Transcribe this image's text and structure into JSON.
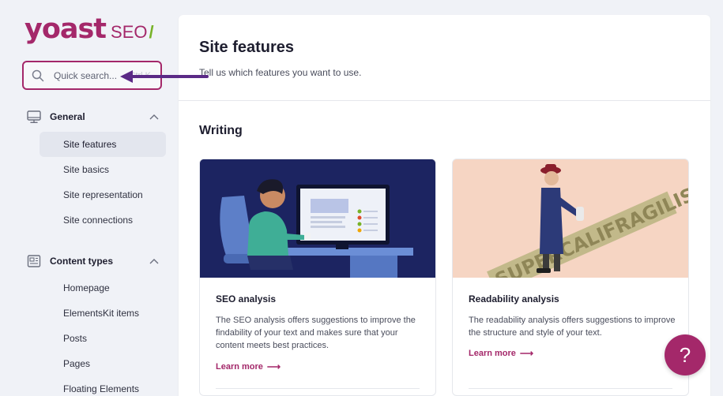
{
  "brand": {
    "logo_word": "yoast",
    "logo_suffix": "SEO",
    "logo_slash": "/",
    "primary_color": "#a4286a",
    "accent_color": "#77b227"
  },
  "search": {
    "placeholder": "Quick search...",
    "shortcut": "Ctrl K",
    "icon": "search-icon"
  },
  "sidebar": {
    "sections": [
      {
        "label": "General",
        "icon": "desktop-icon",
        "expanded": true,
        "items": [
          {
            "label": "Site features",
            "active": true
          },
          {
            "label": "Site basics",
            "active": false
          },
          {
            "label": "Site representation",
            "active": false
          },
          {
            "label": "Site connections",
            "active": false
          }
        ]
      },
      {
        "label": "Content types",
        "icon": "newspaper-icon",
        "expanded": true,
        "items": [
          {
            "label": "Homepage",
            "active": false
          },
          {
            "label": "ElementsKit items",
            "active": false
          },
          {
            "label": "Posts",
            "active": false
          },
          {
            "label": "Pages",
            "active": false
          },
          {
            "label": "Floating Elements",
            "active": false
          }
        ]
      }
    ]
  },
  "main": {
    "title": "Site features",
    "subtitle": "Tell us which features you want to use.",
    "section_title": "Writing",
    "cards": [
      {
        "title": "SEO analysis",
        "description": "The SEO analysis offers suggestions to improve the findability of your text and makes sure that your content meets best practices.",
        "link": "Learn more",
        "link_arrow": "⟶"
      },
      {
        "title": "Readability analysis",
        "description": "The readability analysis offers suggestions to improve the structure and style of your text.",
        "link": "Learn more",
        "link_arrow": "⟶",
        "illustration_text": "SUPERCALIFRAGILISTICEXPIALIDOCIOUS"
      }
    ]
  },
  "help": {
    "label": "?"
  }
}
